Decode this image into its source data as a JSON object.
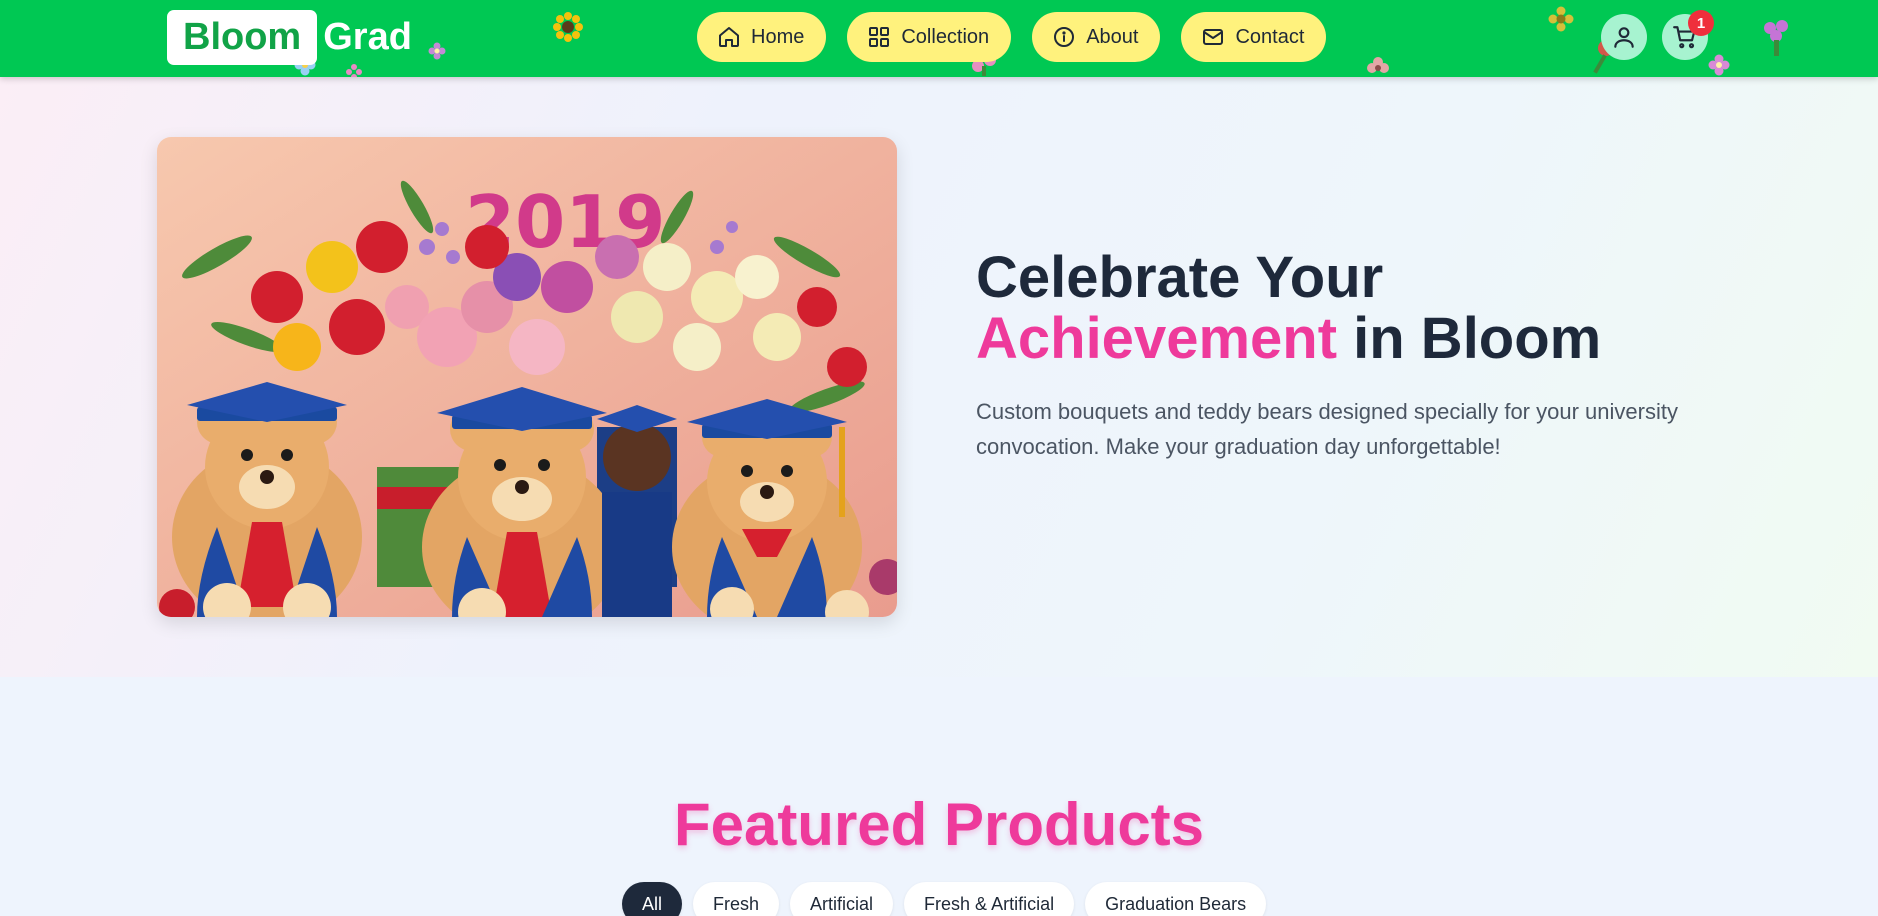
{
  "header": {
    "logo_box": "Bloom",
    "logo_text": "Grad",
    "nav": [
      {
        "label": "Home",
        "icon": "home-icon"
      },
      {
        "label": "Collection",
        "icon": "grid-icon"
      },
      {
        "label": "About",
        "icon": "info-icon"
      },
      {
        "label": "Contact",
        "icon": "mail-icon"
      }
    ],
    "cart_count": "1"
  },
  "hero": {
    "title_line1": "Celebrate Your",
    "title_highlight": "Achievement",
    "title_rest": " in Bloom",
    "subtitle": "Custom bouquets and teddy bears designed specially for your university convocation. Make your graduation day unforgettable!",
    "image_year": "2019"
  },
  "featured": {
    "title": "Featured Products",
    "filters": [
      "All",
      "Fresh",
      "Artificial",
      "Fresh & Artificial",
      "Graduation Bears"
    ],
    "active_filter": "All"
  },
  "colors": {
    "header_green": "#00c853",
    "nav_yellow": "#fff27d",
    "accent_pink": "#ee3a9b",
    "dark": "#1e293b",
    "badge_red": "#ef2f3c"
  }
}
